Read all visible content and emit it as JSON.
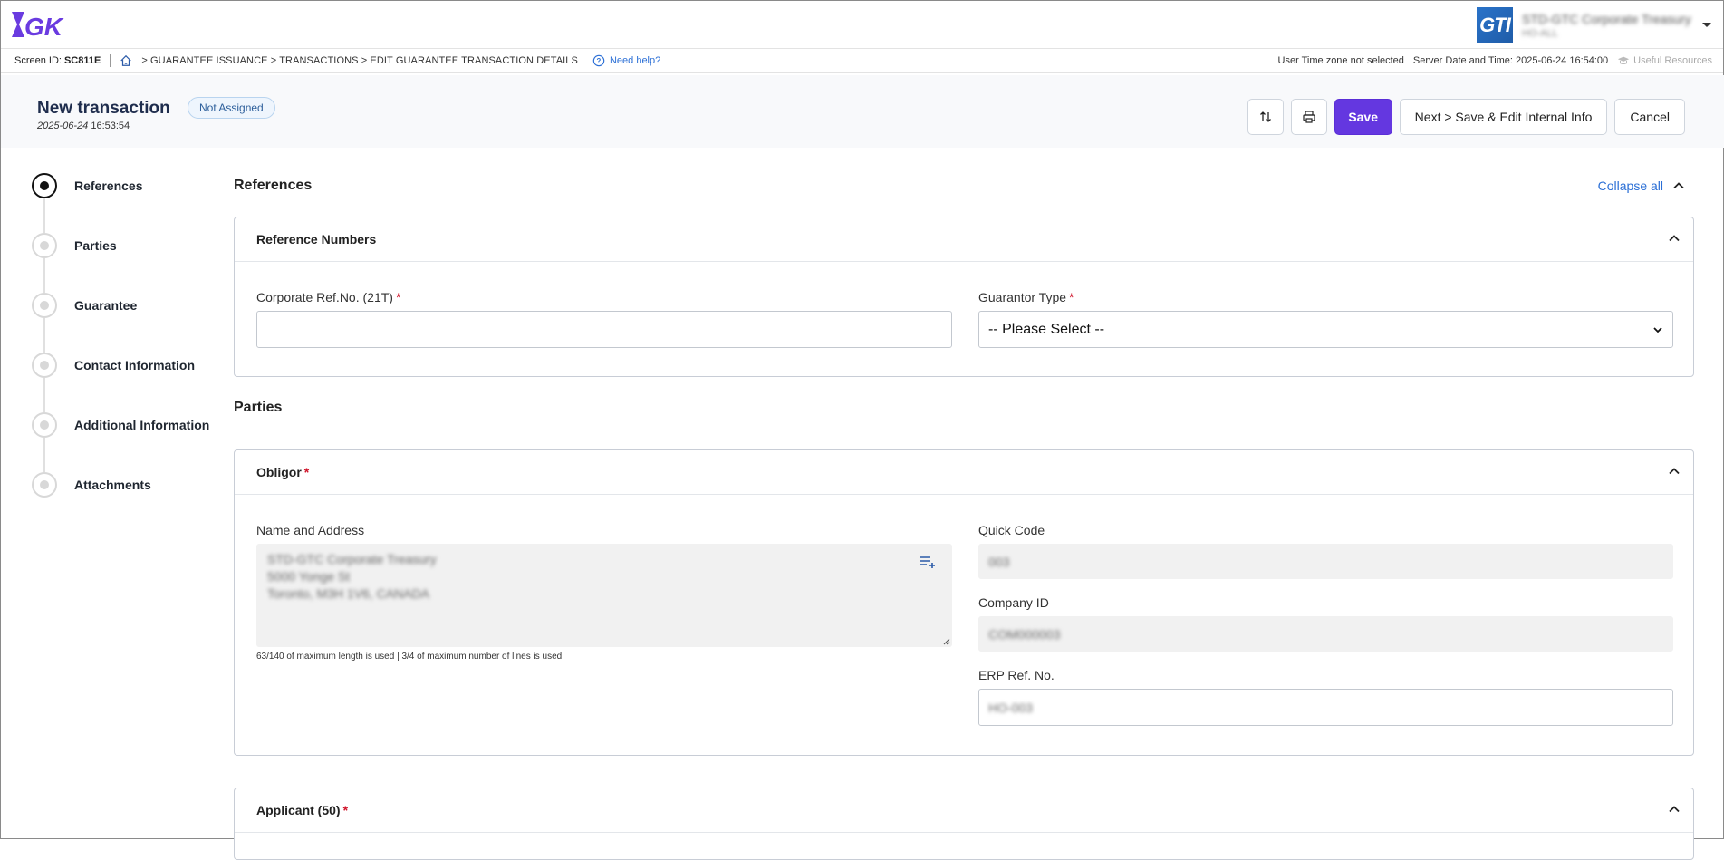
{
  "topbar": {
    "logo_text": "GTK",
    "account": {
      "badge": "GTI",
      "name": "STD-GTC Corporate Treasury",
      "sub": "HO-ALL"
    }
  },
  "crumbbar": {
    "screen_label": "Screen ID:",
    "screen_id": "SC811E",
    "breadcrumb": ">  GUARANTEE ISSUANCE > TRANSACTIONS > EDIT GUARANTEE TRANSACTION DETAILS",
    "help": "Need help?",
    "timezone": "User Time zone not selected",
    "server_time": "Server Date and Time: 2025-06-24 16:54:00",
    "useful": "Useful Resources"
  },
  "header": {
    "title": "New transaction",
    "date": "2025-06-24",
    "time": "16:53:54",
    "status": "Not Assigned",
    "save": "Save",
    "next": "Next > Save & Edit Internal Info",
    "cancel": "Cancel"
  },
  "steps": [
    {
      "label": "References",
      "active": true
    },
    {
      "label": "Parties",
      "active": false
    },
    {
      "label": "Guarantee",
      "active": false
    },
    {
      "label": "Contact Information",
      "active": false
    },
    {
      "label": "Additional Information",
      "active": false
    },
    {
      "label": "Attachments",
      "active": false
    }
  ],
  "references": {
    "title": "References",
    "collapse_all": "Collapse all",
    "card_title": "Reference Numbers",
    "corp_ref_label": "Corporate Ref.No. (21T)",
    "corp_ref_value": "",
    "guarantor_type_label": "Guarantor Type",
    "guarantor_type_value": "-- Please Select --"
  },
  "parties": {
    "title": "Parties",
    "obligor": {
      "title": "Obligor",
      "name_address_label": "Name and Address",
      "name_address_lines": [
        "STD-GTC Corporate Treasury",
        "5000 Yonge St",
        "Toronto, M3H 1V6, CANADA"
      ],
      "usage_note": "63/140 of maximum length is used | 3/4 of maximum number of lines is used",
      "quick_code_label": "Quick Code",
      "quick_code_value": "003",
      "company_id_label": "Company ID",
      "company_id_value": "COM000003",
      "erp_label": "ERP Ref. No.",
      "erp_value": "HO-003"
    },
    "applicant_title": "Applicant (50)"
  },
  "required_mark": "*",
  "colors": {
    "primary": "#6437e0",
    "link": "#2b6fd6",
    "required": "#d0152b"
  }
}
